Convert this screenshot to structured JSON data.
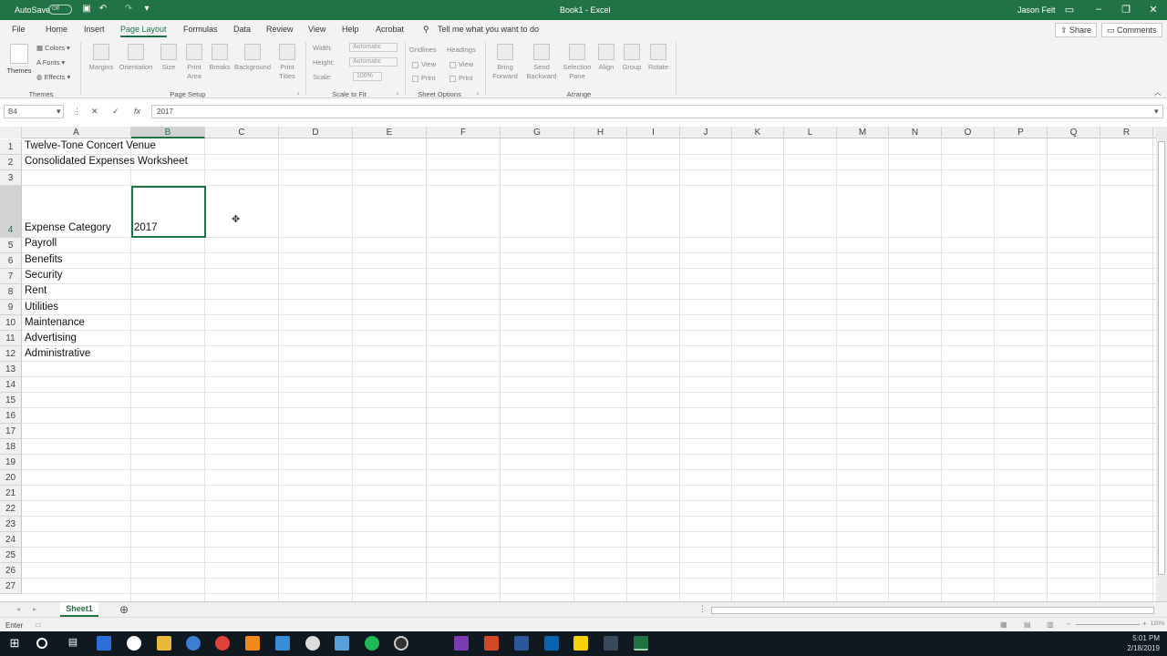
{
  "app": {
    "window_title": "Book1 - Excel",
    "user": "Jason Felt",
    "autosave_label": "AutoSave",
    "autosave_state": "Off",
    "quick_access": [
      "save-icon",
      "undo-icon",
      "redo-icon",
      "customize-icon"
    ],
    "colors": {
      "accent": "#217346",
      "ribbon_bg": "#f3f3f3",
      "taskbar_bg": "#101820"
    }
  },
  "menu": {
    "tabs": [
      "File",
      "Home",
      "Insert",
      "Page Layout",
      "Formulas",
      "Data",
      "Review",
      "View",
      "Help",
      "Acrobat"
    ],
    "active_tab": "Page Layout",
    "tell_me": "Tell me what you want to do",
    "share": "Share",
    "comments": "Comments"
  },
  "ribbon": {
    "themes": {
      "themes": "Themes",
      "colors": "Colors",
      "fonts": "Fonts",
      "effects": "Effects",
      "group": "Themes"
    },
    "page_setup": {
      "margins": "Margins",
      "orientation": "Orientation",
      "size": "Size",
      "print_area_1": "Print",
      "print_area_2": "Area",
      "breaks": "Breaks",
      "background": "Background",
      "print_titles_1": "Print",
      "print_titles_2": "Titles",
      "group": "Page Setup"
    },
    "scale": {
      "width": "Width:",
      "width_val": "Automatic",
      "height": "Height:",
      "height_val": "Automatic",
      "scale": "Scale:",
      "scale_val": "100%",
      "group": "Scale to Fit"
    },
    "sheet_options": {
      "gridlines": "Gridlines",
      "headings": "Headings",
      "view": "View",
      "print": "Print",
      "group": "Sheet Options"
    },
    "arrange": {
      "bring_1": "Bring",
      "bring_2": "Forward",
      "send_1": "Send",
      "send_2": "Backward",
      "selection_1": "Selection",
      "selection_2": "Pane",
      "align": "Align",
      "group_btn": "Group",
      "rotate": "Rotate",
      "group": "Arrange"
    }
  },
  "formula_bar": {
    "name_box": "B4",
    "formula": "2017"
  },
  "grid": {
    "columns": [
      "A",
      "B",
      "C",
      "D",
      "E",
      "F",
      "G",
      "H",
      "I",
      "J",
      "K",
      "L",
      "M",
      "N",
      "O",
      "P",
      "Q",
      "R"
    ],
    "selected_column": "B",
    "selected_row": "4",
    "rows": [
      "1",
      "2",
      "3",
      "4",
      "5",
      "6",
      "7",
      "8",
      "9",
      "10",
      "11",
      "12",
      "13",
      "14",
      "15",
      "16",
      "17",
      "18",
      "19",
      "20",
      "21",
      "22",
      "23",
      "24",
      "25",
      "26",
      "27"
    ],
    "cells": {
      "A1": "Twelve-Tone Concert Venue",
      "A2": "Consolidated Expenses Worksheet",
      "A4": "Expense Category",
      "B4": "2017",
      "A5": "Payroll",
      "A6": "Benefits",
      "A7": "Security",
      "A8": "Rent",
      "A9": "Utilities",
      "A10": "Maintenance",
      "A11": "Advertising",
      "A12": "Administrative"
    }
  },
  "sheets": {
    "tabs": [
      "Sheet1"
    ],
    "active": "Sheet1"
  },
  "status": {
    "mode": "Enter",
    "zoom": "120%"
  },
  "taskbar": {
    "apps": [
      "start-icon",
      "cortana-icon",
      "task-view-icon",
      "store-icon",
      "xbox-icon",
      "file-explorer-icon",
      "app-icon",
      "chrome-icon",
      "vlc-icon",
      "steam-icon",
      "app-icon-2",
      "app-icon-3",
      "spotify-icon",
      "obs-icon",
      "onenote-icon",
      "powerpoint-icon",
      "word-icon",
      "outlook-icon",
      "sticky-notes-icon",
      "app-icon-4",
      "excel-icon"
    ],
    "time": "5:01 PM",
    "date": "2/18/2019"
  }
}
